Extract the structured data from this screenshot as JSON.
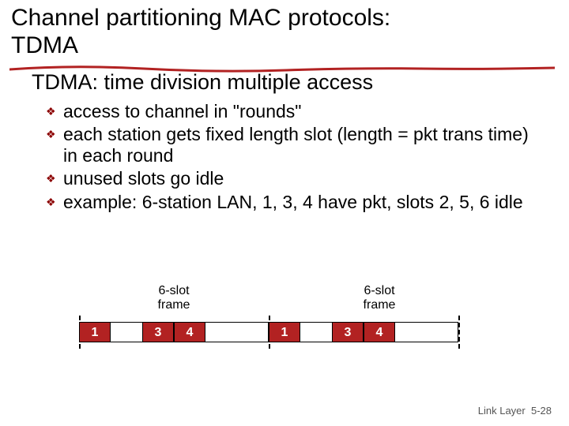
{
  "title_line1": "Channel partitioning MAC protocols:",
  "title_line2": "TDMA",
  "subtitle": "TDMA: time division multiple access",
  "bullets": [
    "access to channel in \"rounds\"",
    "each station gets fixed length slot (length = pkt trans time) in each round",
    "unused slots go idle",
    "example: 6-station LAN, 1, 3, 4 have pkt, slots 2, 5, 6 idle"
  ],
  "frame_label_line1": "6-slot",
  "frame_label_line2": "frame",
  "slots_frame1": [
    "1",
    "",
    "3",
    "4",
    "",
    ""
  ],
  "slots_frame2": [
    "1",
    "",
    "3",
    "4",
    "",
    ""
  ],
  "footer_prefix": "Link Layer",
  "footer_page": "5-28",
  "colors": {
    "accent": "#b22222",
    "bullet": "#8B0000"
  }
}
